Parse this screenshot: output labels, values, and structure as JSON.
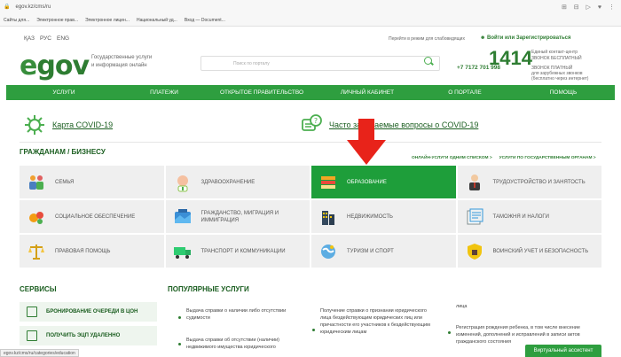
{
  "browser": {
    "url": "egov.kz/cms/ru",
    "bookmarks": [
      "Сайты для...",
      "Электронное прав...",
      "Электронное лицен...",
      "Национальный уд...",
      "Вход — Document..."
    ]
  },
  "topbar": {
    "languages": [
      "ҚАЗ",
      "РУС",
      "ENG"
    ],
    "accessibility": "Перейти в режим для слабовидящих",
    "login": "Войти или Зарегистрироваться"
  },
  "header": {
    "logo_e": "e",
    "logo_rest": "gov",
    "tagline": [
      "Государственные услуги",
      "и информация онлайн"
    ],
    "search_placeholder": "Поиск по порталу",
    "call_number": "1414",
    "call_text": [
      "Единый контакт-центр",
      "ЗВОНОК БЕСПЛАТНЫЙ"
    ],
    "phone": "+7 7172 701 998",
    "phone_text": [
      "ЗВОНОК ПЛАТНЫЙ",
      "для зарубежных звонков",
      "(бесплатно через интернет)"
    ]
  },
  "nav": [
    "УСЛУГИ",
    "ПЛАТЕЖИ",
    "ОТКРЫТОЕ ПРАВИТЕЛЬСТВО",
    "ЛИЧНЫЙ КАБИНЕТ",
    "О ПОРТАЛЕ",
    "ПОМОЩЬ"
  ],
  "features": {
    "covid_map": "Карта COVID-19",
    "covid_faq": "Часто задаваемые вопросы о COVID-19"
  },
  "categories": {
    "title": "ГРАЖДАНАМ / БИЗНЕСУ",
    "link_list": "ОНЛАЙН-УСЛУГИ ОДНИМ СПИСКОМ >",
    "link_organs": "УСЛУГИ ПО ГОСУДАРСТВЕННЫМ ОРГАНАМ >",
    "items": [
      {
        "label": "СЕМЬЯ",
        "icon": "family-icon"
      },
      {
        "label": "ЗДРАВООХРАНЕНИЕ",
        "icon": "health-icon"
      },
      {
        "label": "ОБРАЗОВАНИЕ",
        "icon": "education-icon",
        "active": true
      },
      {
        "label": "ТРУДОУСТРОЙСТВО И ЗАНЯТОСТЬ",
        "icon": "employment-icon"
      },
      {
        "label": "СОЦИАЛЬНОЕ ОБЕСПЕЧЕНИЕ",
        "icon": "social-icon"
      },
      {
        "label": "ГРАЖДАНСТВО, МИГРАЦИЯ И ИММИГРАЦИЯ",
        "icon": "migration-icon"
      },
      {
        "label": "НЕДВИЖИМОСТЬ",
        "icon": "realty-icon"
      },
      {
        "label": "ТАМОЖНЯ И НАЛОГИ",
        "icon": "customs-icon"
      },
      {
        "label": "ПРАВОВАЯ ПОМОЩЬ",
        "icon": "scales-icon"
      },
      {
        "label": "ТРАНСПОРТ И КОММУНИКАЦИИ",
        "icon": "truck-icon"
      },
      {
        "label": "ТУРИЗМ И СПОРТ",
        "icon": "tourism-icon"
      },
      {
        "label": "ВОИНСКИЙ УЧЕТ И БЕЗОПАСНОСТЬ",
        "icon": "military-icon"
      }
    ]
  },
  "services": {
    "title": "СЕРВИСЫ",
    "items": [
      "БРОНИРОВАНИЕ ОЧЕРЕДИ В ЦОН",
      "ПОЛУЧИТЬ ЭЦП УДАЛЕННО"
    ]
  },
  "popular": {
    "title": "ПОПУЛЯРНЫЕ УСЛУГИ",
    "items": [
      "Выдача справки о наличии либо отсутствии судимости",
      "Выдача справки об отсутствии (наличии) недвижимого имущества юридического",
      "Получение справки о признании юридического лица бездействующим юридических лиц или причастности его участников к бездействующим юридическим лицам",
      "лица",
      "Регистрация рождения ребенка, в том числе внесение изменений, дополнений и исправлений в записи актов гражданского состояния"
    ]
  },
  "status_url": "egov.kz/cms/ru/categories/education",
  "assistant": "Виртуальный ассистент",
  "colors": {
    "brand_green": "#2e9e3f",
    "dark_green": "#1b5e20",
    "arrow_red": "#e8231a"
  }
}
